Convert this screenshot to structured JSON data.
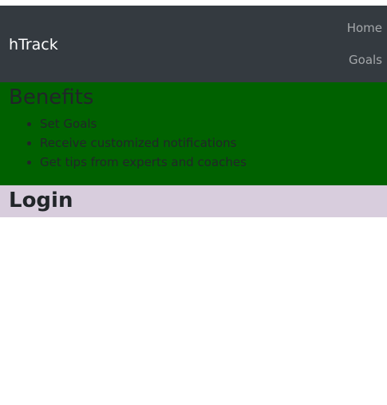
{
  "navbar": {
    "brand": "hTrack",
    "links": [
      {
        "label": "Home"
      },
      {
        "label": "Goals"
      }
    ]
  },
  "benefits": {
    "heading": "Benefits",
    "items": [
      "Set Goals",
      "Receive customized notifications",
      "Get tips from experts and coaches"
    ]
  },
  "login": {
    "heading": "Login"
  },
  "colors": {
    "navbar_bg": "#343a40",
    "benefits_bg": "#006100",
    "login_bg": "#d8cddd"
  }
}
